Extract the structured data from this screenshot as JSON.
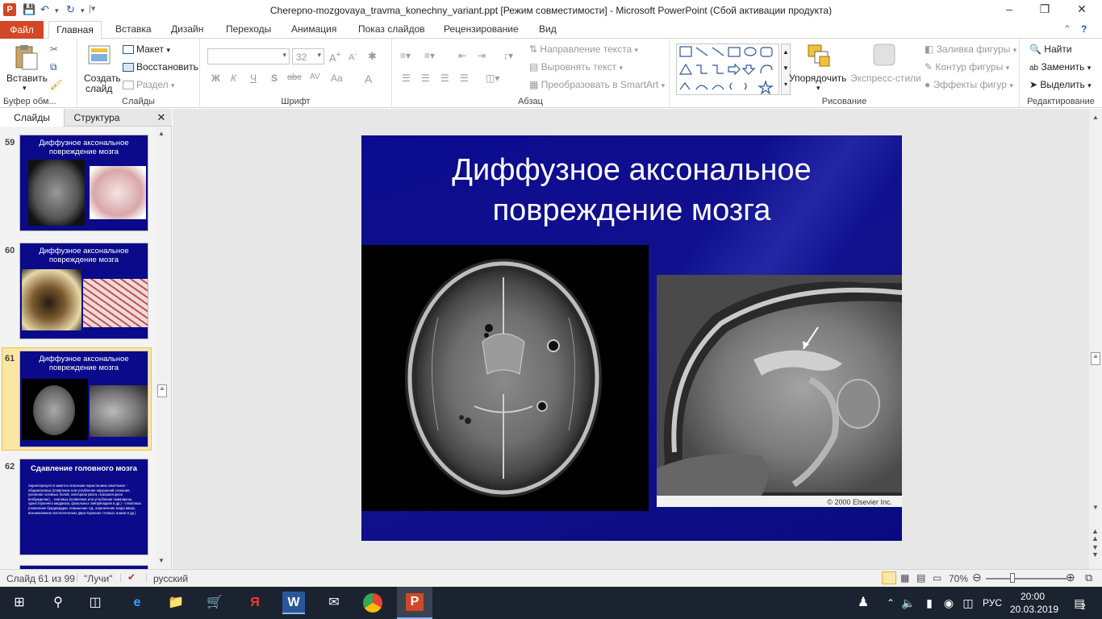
{
  "window": {
    "title": "Cherepno-mozgovaya_travma_konechny_variant.ppt [Режим совместимости]  -  Microsoft PowerPoint (Сбой активации продукта)",
    "app_icon": "P",
    "accent": "#d24726"
  },
  "tabs": [
    "Файл",
    "Главная",
    "Вставка",
    "Дизайн",
    "Переходы",
    "Анимация",
    "Показ слайдов",
    "Рецензирование",
    "Вид"
  ],
  "ribbon": {
    "clipboard": {
      "paste": "Вставить",
      "label": "Буфер обм..."
    },
    "slides": {
      "new_slide_1": "Создать",
      "new_slide_2": "слайд",
      "layout": "Макет",
      "reset": "Восстановить",
      "section": "Раздел",
      "label": "Слайды"
    },
    "font": {
      "size": "32",
      "bold": "Ж",
      "italic": "К",
      "underline": "Ч",
      "shadow": "S",
      "strike": "abc",
      "spacing": "AV",
      "case": "Aa",
      "label": "Шрифт"
    },
    "paragraph": {
      "text_direction": "Направление текста",
      "align_text": "Выровнять текст",
      "smartart": "Преобразовать в SmartArt",
      "label": "Абзац"
    },
    "drawing": {
      "arrange": "Упорядочить",
      "quick_styles": "Экспресс-стили",
      "fill": "Заливка фигуры",
      "outline": "Контур фигуры",
      "effects": "Эффекты фигур",
      "label": "Рисование"
    },
    "editing": {
      "find": "Найти",
      "replace": "Заменить",
      "select": "Выделить",
      "label": "Редактирование"
    }
  },
  "panel": {
    "tab_slides": "Слайды",
    "tab_outline": "Структура",
    "thumbnails": [
      {
        "num": "59",
        "title": "Диффузное аксональное повреждение мозга"
      },
      {
        "num": "60",
        "title": "Диффузное аксональное повреждение мозга"
      },
      {
        "num": "61",
        "title": "Диффузное аксональное повреждение мозга"
      },
      {
        "num": "62",
        "title": "Сдавление головного мозга",
        "body": "Характеризуется   заметно опасными нарастанием симптомов: - общемозговых (появление или углубление нарушений сознания, усиление головных болей, повторная рвота, психомоторное возбуждение), - очаговых (появление или углубление гемипареза, одностороннего мидриаза, фокальных эпиприпадков и др.) - стволовых (появление брадикардии, повышение АД, ограничение взора вверх, возникновение патологических двухсторонних стопных знаков и др.)"
      }
    ]
  },
  "slide": {
    "title_line1": "Диффузное аксональное",
    "title_line2": "повреждение мозга",
    "copyright": "© 2000 Elsevier Inc."
  },
  "status": {
    "slide_pos": "Слайд 61 из 99",
    "theme": "\"Лучи\"",
    "lang": "русский",
    "zoom": "70%"
  },
  "taskbar": {
    "lang": "РУС",
    "time": "20:00",
    "date": "20.03.2019",
    "notifications": "2"
  }
}
